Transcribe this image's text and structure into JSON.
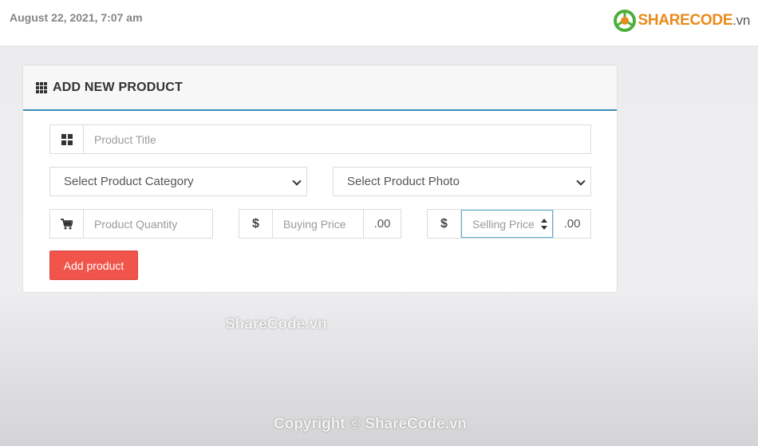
{
  "header": {
    "datetime": "August 22, 2021, 7:07 am",
    "logo_main": "SHARECODE",
    "logo_suffix": ".vn"
  },
  "panel": {
    "icon": "th-grid-icon",
    "title": "ADD NEW PRODUCT"
  },
  "form": {
    "title_placeholder": "Product Title",
    "category_selected": "Select Product Category",
    "photo_selected": "Select Product Photo",
    "quantity_placeholder": "Product Quantity",
    "buying_price_placeholder": "Buying Price",
    "selling_price_placeholder": "Selling Price",
    "currency_symbol": "$",
    "cents_suffix": ".00",
    "submit_label": "Add product"
  },
  "watermarks": {
    "center": "ShareCode.vn",
    "footer": "Copyright © ShareCode.vn"
  },
  "colors": {
    "accent_border": "#3c8dbc",
    "button_bg": "#f0544a",
    "logo_orange": "#e88a1a",
    "logo_green": "#4caf3c"
  }
}
